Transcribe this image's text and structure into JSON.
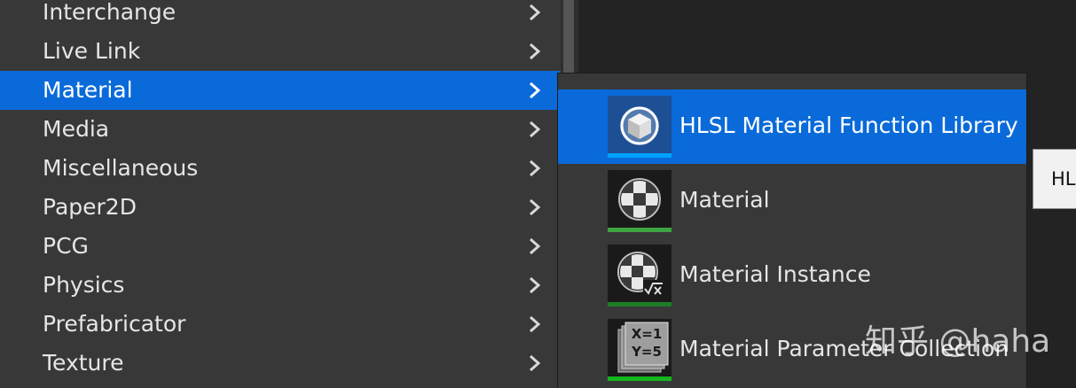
{
  "categories": [
    {
      "label": "Interchange"
    },
    {
      "label": "Live Link"
    },
    {
      "label": "Material"
    },
    {
      "label": "Media"
    },
    {
      "label": "Miscellaneous"
    },
    {
      "label": "Paper2D"
    },
    {
      "label": "PCG"
    },
    {
      "label": "Physics"
    },
    {
      "label": "Prefabricator"
    },
    {
      "label": "Texture"
    }
  ],
  "active_category": "Material",
  "submenu": {
    "items": [
      {
        "label": "HLSL Material Function Library",
        "icon": "hlsl-function-library-icon",
        "accent": "#00a2ff"
      },
      {
        "label": "Material",
        "icon": "material-sphere-icon",
        "accent": "#3ea543"
      },
      {
        "label": "Material Instance",
        "icon": "material-instance-icon",
        "accent": "#1d7d28"
      },
      {
        "label": "Material Parameter Collection",
        "icon": "parameter-collection-icon",
        "accent": "#15b51f"
      }
    ],
    "icon_text": {
      "x": "X=1",
      "y": "Y=5"
    },
    "active_index": 0
  },
  "tooltip": {
    "text": "HL"
  },
  "watermark": {
    "text": "知乎 @haha"
  },
  "colors": {
    "highlight": "#0a6ad9",
    "menu_bg": "#383838",
    "text": "#e6e6e6"
  }
}
